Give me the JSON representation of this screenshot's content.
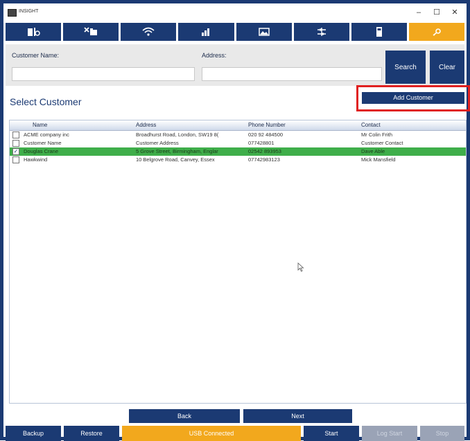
{
  "window": {
    "title": "INSIGHT",
    "controls": {
      "minimize": "–",
      "maximize": "☐",
      "close": "✕"
    }
  },
  "toolbar": {
    "buttons": [
      {
        "icon": "vehicle-search-icon"
      },
      {
        "icon": "tools-folder-icon"
      },
      {
        "icon": "wifi-icon"
      },
      {
        "icon": "chart-icon"
      },
      {
        "icon": "image-icon"
      },
      {
        "icon": "settings-sliders-icon"
      },
      {
        "icon": "calculator-icon"
      },
      {
        "icon": "key-icon",
        "active": true
      }
    ]
  },
  "search": {
    "customer_name_label": "Customer Name:",
    "customer_name_value": "",
    "address_label": "Address:",
    "address_value": "",
    "search_label": "Search",
    "clear_label": "Clear"
  },
  "select_customer_title": "Select Customer",
  "add_customer_label": "Add Customer",
  "table": {
    "headers": [
      "Name",
      "Address",
      "Phone Number",
      "Contact"
    ],
    "rows": [
      {
        "name": "ACME company inc",
        "address": "Broadhurst Road, London, SW19 8(",
        "phone": "020 92 484500",
        "contact": "Mr Colin Frith",
        "checked": false,
        "selected": false
      },
      {
        "name": "Customer Name",
        "address": "Customer Address",
        "phone": "077428801",
        "contact": "Customer Contact",
        "checked": false,
        "selected": false
      },
      {
        "name": "Douglas Crane",
        "address": "5 Grove Street, Birmingham, Englar",
        "phone": "02542 893953",
        "contact": "Dave Able",
        "checked": true,
        "selected": true
      },
      {
        "name": "Hawkwind",
        "address": "10 Belgrove Road, Canvey, Essex",
        "phone": "07742983123",
        "contact": "Mick Mansfield",
        "checked": false,
        "selected": false
      }
    ]
  },
  "nav": {
    "back_label": "Back",
    "next_label": "Next"
  },
  "bottom": {
    "backup_label": "Backup",
    "restore_label": "Restore",
    "usb_status": "USB Connected",
    "start_label": "Start",
    "log_start_label": "Log Start",
    "stop_label": "Stop"
  },
  "colors": {
    "navy": "#1b3a73",
    "accent": "#f2a81d",
    "selected_row": "#3fae4a",
    "highlight_border": "#e02020"
  }
}
